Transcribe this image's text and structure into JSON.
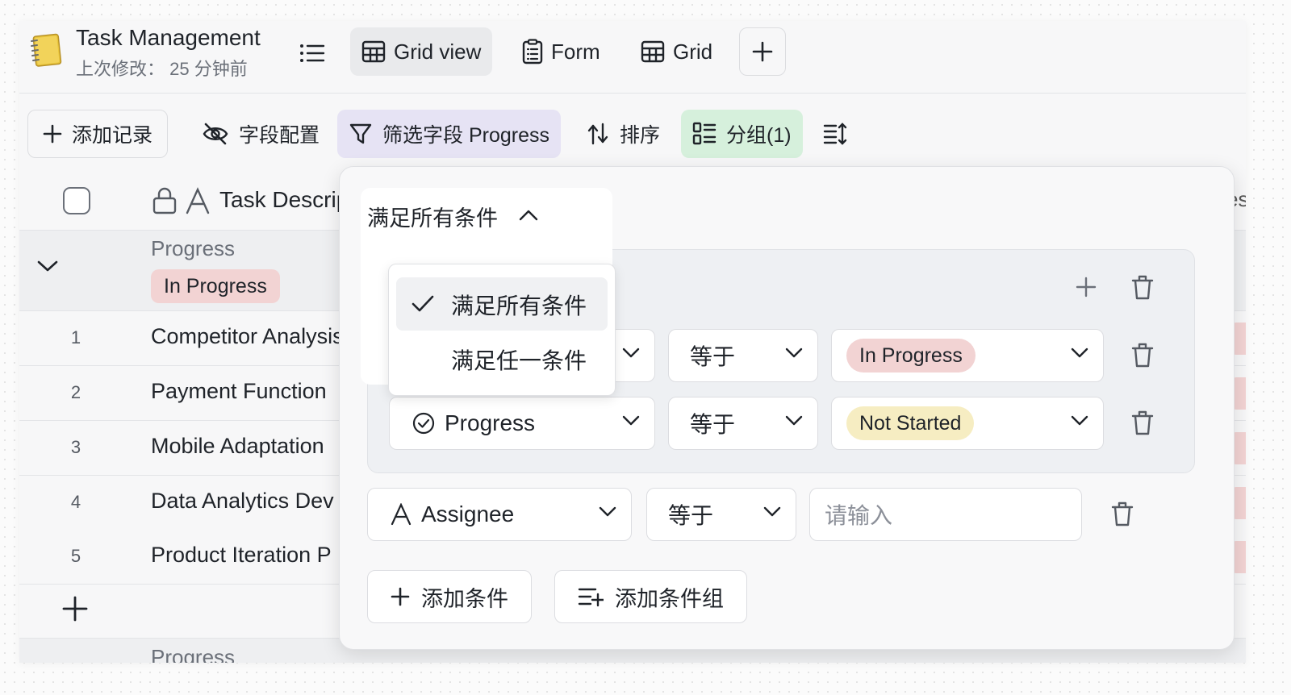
{
  "header": {
    "title": "Task Management",
    "subtitle": "上次修改： 25 分钟前",
    "views": [
      {
        "label": "Grid view",
        "icon": "grid-icon",
        "active": true
      },
      {
        "label": "Form",
        "icon": "form-icon",
        "active": false
      },
      {
        "label": "Grid",
        "icon": "grid-icon",
        "active": false
      }
    ]
  },
  "toolbar": {
    "add_record": "添加记录",
    "field_config": "字段配置",
    "filter": "筛选字段 Progress",
    "sort": "排序",
    "group": "分组(1)"
  },
  "table": {
    "column_header": "Task Description",
    "group": {
      "field": "Progress",
      "value": "In Progress"
    },
    "rows": [
      {
        "num": "1",
        "text": "Competitor Analysis"
      },
      {
        "num": "2",
        "text": "Payment Function"
      },
      {
        "num": "3",
        "text": "Mobile Adaptation"
      },
      {
        "num": "4",
        "text": "Data Analytics Dev"
      },
      {
        "num": "5",
        "text": "Product Iteration P"
      }
    ],
    "next_group_field": "Progress",
    "edge_text": "es"
  },
  "filter_panel": {
    "logic_selected": "满足所有条件",
    "logic_options": [
      "满足所有条件",
      "满足任一条件"
    ],
    "group_conditions": [
      {
        "field": "Progress",
        "operator": "等于",
        "value": "In Progress",
        "value_color": "#f2d3d3"
      },
      {
        "field": "Progress",
        "operator": "等于",
        "value": "Not Started",
        "value_color": "#f6edc2"
      }
    ],
    "condition": {
      "field": "Assignee",
      "operator": "等于",
      "placeholder": "请输入"
    },
    "add_condition": "添加条件",
    "add_condition_group": "添加条件组"
  }
}
